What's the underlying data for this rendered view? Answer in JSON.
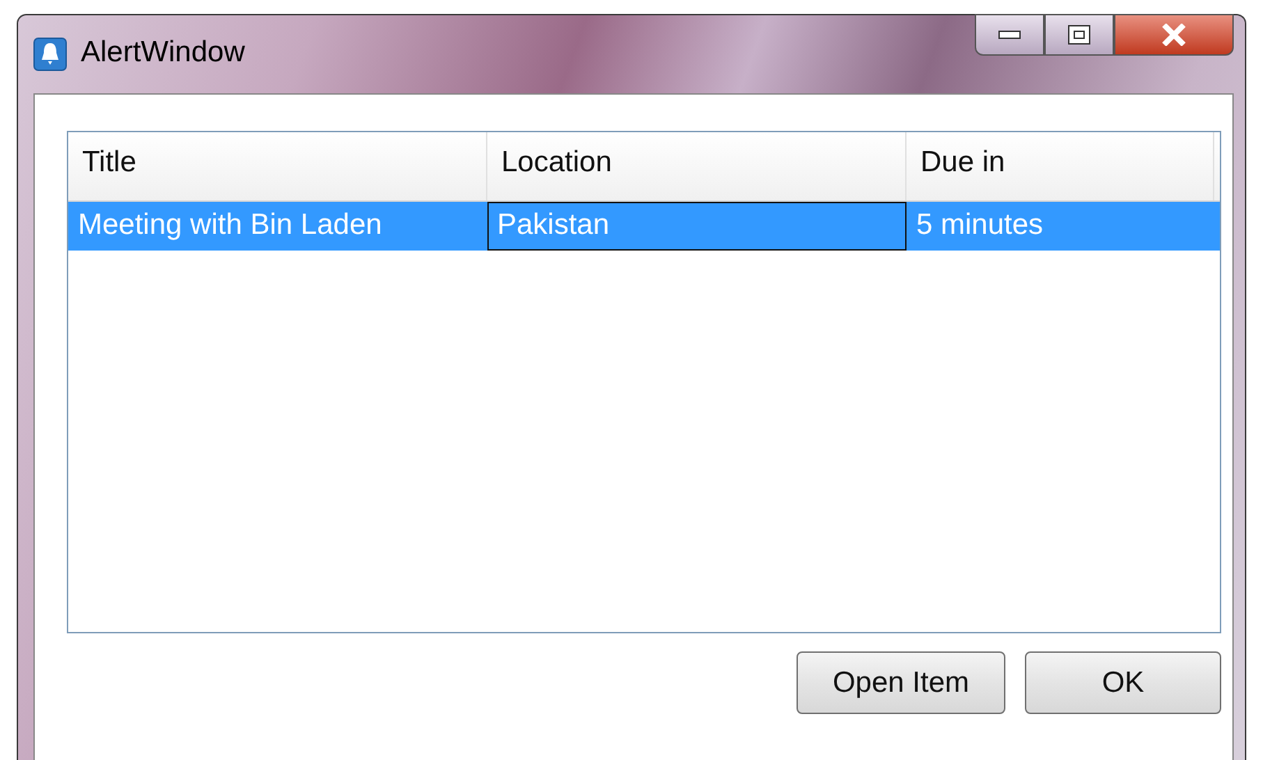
{
  "window": {
    "title": "AlertWindow"
  },
  "table": {
    "columns": [
      "Title",
      "Location",
      "Due in"
    ],
    "rows": [
      {
        "selected": true,
        "cells": [
          {
            "text": "Meeting with Bin Laden",
            "focused": false
          },
          {
            "text": "Pakistan",
            "focused": true
          },
          {
            "text": "5 minutes",
            "focused": false
          }
        ]
      }
    ]
  },
  "buttons": [
    "Open Item",
    "OK"
  ]
}
